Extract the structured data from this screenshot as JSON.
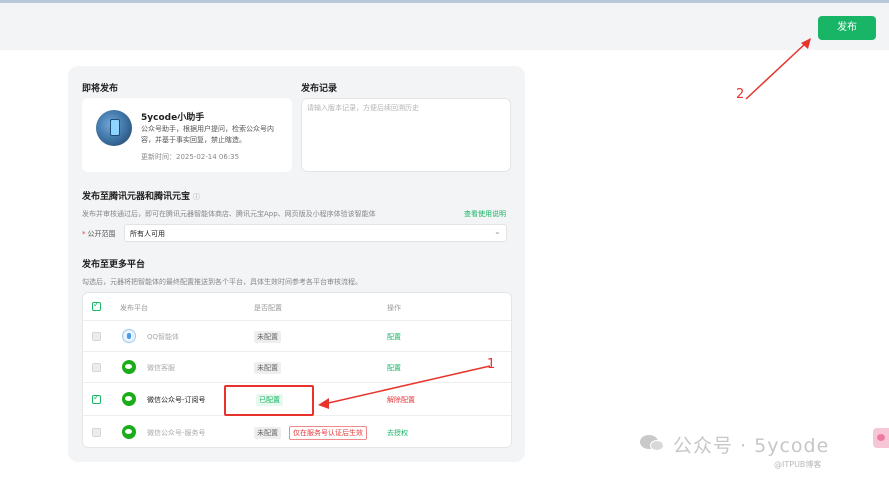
{
  "header": {
    "publish_button": "发布"
  },
  "publish_card": {
    "upcoming_title": "即将发布",
    "agent": {
      "name": "5ycode小助手",
      "description": "公众号助手，根据用户提问，检索公众号内容，并基于事实回复，禁止瞎造。",
      "updated": "更新时间：2025-02-14 06:35"
    },
    "record_title": "发布记录",
    "record_placeholder": "请输入版本记录，方便后续回溯历史",
    "tencent_title": "发布至腾讯元器和腾讯元宝",
    "tencent_desc": "发布并审核通过后，即可在腾讯元器智能体商店、腾讯元宝App、网页版及小程序体验该智能体",
    "usage_link": "查看使用说明",
    "scope_label": "公开范围",
    "scope_required": "*",
    "scope_value": "所有人可用",
    "more_title": "发布至更多平台",
    "more_desc": "勾选后，元器将把智能体的最终配置推送到各个平台，具体生效时间参考各平台审核流程。"
  },
  "platform_table": {
    "headers": [
      "发布平台",
      "是否配置",
      "操作"
    ],
    "rows": [
      {
        "name": "QQ智能体",
        "status": "未配置",
        "action": "配置",
        "checked": false
      },
      {
        "name": "微信客服",
        "status": "未配置",
        "action": "配置",
        "checked": false
      },
      {
        "name": "微信公众号-订阅号",
        "status": "已配置",
        "action": "解除配置",
        "checked": true
      },
      {
        "name": "微信公众号-服务号",
        "status": "未配置",
        "note": "仅在服务号认证后生效",
        "action": "去授权",
        "checked": false
      }
    ]
  },
  "annotations": {
    "label_1": "1",
    "label_2": "2",
    "color": "#e8332c"
  },
  "watermark": {
    "main": "公众号 · 5ycode",
    "sub": "@ITPUB博客"
  },
  "colors": {
    "accent": "#18b566",
    "danger": "#e4393c"
  }
}
